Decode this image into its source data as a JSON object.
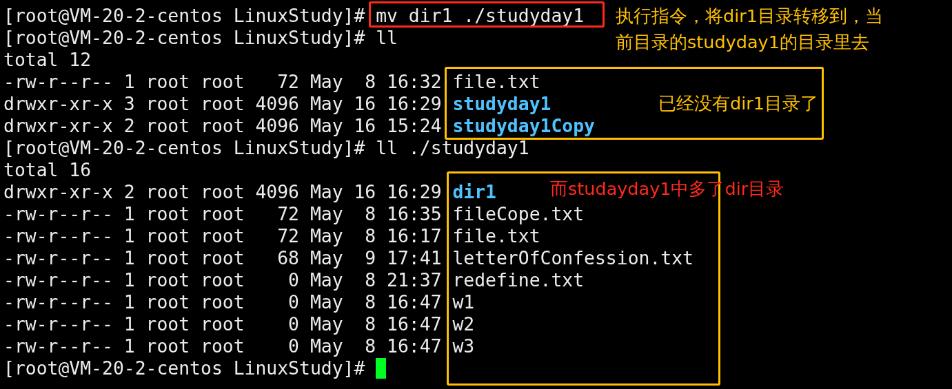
{
  "terminal": {
    "lines": [
      {
        "kind": "prompt",
        "prompt": "[root@VM-20-2-centos LinuxStudy]#",
        "command": "mv dir1 ./studyday1"
      },
      {
        "kind": "prompt",
        "prompt": "[root@VM-20-2-centos LinuxStudy]#",
        "command": "ll"
      },
      {
        "kind": "output",
        "text": "total 12"
      },
      {
        "kind": "entry",
        "meta": "-rw-r--r-- 1 root root   72 May  8 16:32",
        "name": "file.txt",
        "directory": false
      },
      {
        "kind": "entry",
        "meta": "drwxr-xr-x 3 root root 4096 May 16 16:29",
        "name": "studyday1",
        "directory": true
      },
      {
        "kind": "entry",
        "meta": "drwxr-xr-x 2 root root 4096 May 16 15:24",
        "name": "studyday1Copy",
        "directory": true
      },
      {
        "kind": "prompt",
        "prompt": "[root@VM-20-2-centos LinuxStudy]#",
        "command": "ll ./studyday1"
      },
      {
        "kind": "output",
        "text": "total 16"
      },
      {
        "kind": "entry",
        "meta": "drwxr-xr-x 2 root root 4096 May 16 16:29",
        "name": "dir1",
        "directory": true
      },
      {
        "kind": "entry",
        "meta": "-rw-r--r-- 1 root root   72 May  8 16:35",
        "name": "fileCope.txt",
        "directory": false
      },
      {
        "kind": "entry",
        "meta": "-rw-r--r-- 1 root root   72 May  8 16:17",
        "name": "file.txt",
        "directory": false
      },
      {
        "kind": "entry",
        "meta": "-rw-r--r-- 1 root root   68 May  9 17:41",
        "name": "letterOfConfession.txt",
        "directory": false
      },
      {
        "kind": "entry",
        "meta": "-rw-r--r-- 1 root root    0 May  8 21:37",
        "name": "redefine.txt",
        "directory": false
      },
      {
        "kind": "entry",
        "meta": "-rw-r--r-- 1 root root    0 May  8 16:47",
        "name": "w1",
        "directory": false
      },
      {
        "kind": "entry",
        "meta": "-rw-r--r-- 1 root root    0 May  8 16:47",
        "name": "w2",
        "directory": false
      },
      {
        "kind": "entry",
        "meta": "-rw-r--r-- 1 root root    0 May  8 16:47",
        "name": "w3",
        "directory": false
      },
      {
        "kind": "prompt",
        "prompt": "[root@VM-20-2-centos LinuxStudy]#",
        "cursor": true
      }
    ]
  },
  "annotations": [
    {
      "kind": "box",
      "color": "#ff2a1a"
    },
    {
      "kind": "note",
      "lines": [
        "执行指令，将dir1目录转移到，当",
        "前目录的studyday1的目录里去"
      ],
      "color": "#ffc000"
    },
    {
      "kind": "box",
      "color": "#ffc000"
    },
    {
      "kind": "note",
      "lines": [
        "已经没有dir1目录了"
      ],
      "color": "#ffc000"
    },
    {
      "kind": "box",
      "color": "#ffc000"
    },
    {
      "kind": "note",
      "lines": [
        "而studayday1中多了dir目录"
      ],
      "color": "#ff2a1a"
    }
  ]
}
